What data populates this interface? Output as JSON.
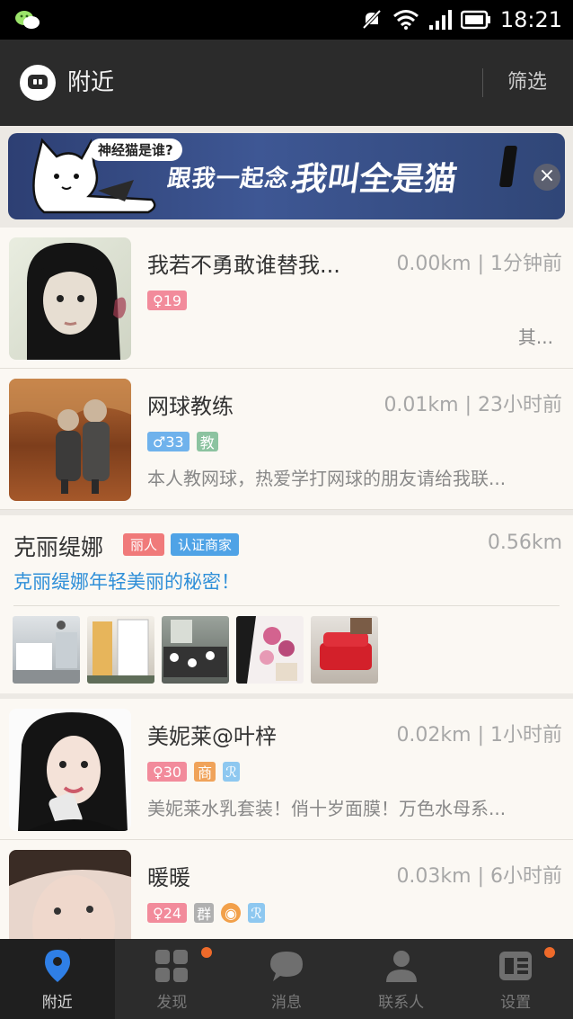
{
  "status_bar": {
    "time": "18:21"
  },
  "header": {
    "title": "附近",
    "filter_label": "筛选"
  },
  "banner": {
    "bubble": "神经猫是谁?",
    "line1": "跟我一起念，",
    "line2": "我叫全是猫",
    "close": "×"
  },
  "people": [
    {
      "name": "我若不勇敢谁替我...",
      "meta": "0.00km | 1分钟前",
      "gender_age": "♀19",
      "bio": "其..."
    },
    {
      "name": "网球教练",
      "meta": "0.01km | 23小时前",
      "gender_age": "♂33",
      "badge": "教",
      "bio": "本人教网球，热爱学打网球的朋友请给我联..."
    }
  ],
  "shop": {
    "name": "克丽缇娜",
    "badge1": "丽人",
    "badge2": "认证商家",
    "distance": "0.56km",
    "slogan": "克丽缇娜年轻美丽的秘密！"
  },
  "people2": [
    {
      "name": "美妮莱@叶梓",
      "meta": "0.02km | 1小时前",
      "gender_age": "♀30",
      "badge": "商",
      "bio": "美妮莱水乳套装！俏十岁面膜！万色水母系..."
    },
    {
      "name": "暖暖",
      "meta": "0.03km | 6小时前",
      "gender_age": "♀24",
      "badge": "群"
    }
  ],
  "tabs": [
    {
      "label": "附近",
      "icon": "location-pin-icon"
    },
    {
      "label": "发现",
      "icon": "grid-icon"
    },
    {
      "label": "消息",
      "icon": "chat-bubble-icon"
    },
    {
      "label": "联系人",
      "icon": "person-icon"
    },
    {
      "label": "设置",
      "icon": "settings-card-icon"
    }
  ],
  "colors": {
    "accent": "#2f8fd8",
    "tab_active": "#2f7fe6",
    "badge_dot": "#ee6a2a"
  }
}
